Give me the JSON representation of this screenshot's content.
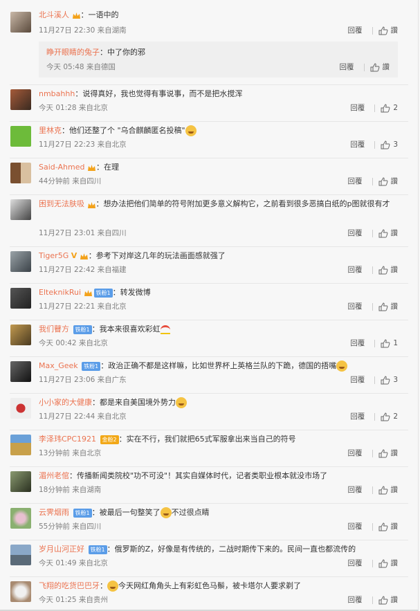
{
  "comments": [
    {
      "nick": "北斗溪人",
      "badge": "",
      "text": "一语中的",
      "emoji": "",
      "time": "11月27日 22:30 来自湖南",
      "reply": "回覆",
      "likes": "讚",
      "sub": {
        "nick": "睁开眼睛的兔子",
        "text": "中了你的邪",
        "time": "今天 05:48 来自德国",
        "reply": "回覆",
        "likes": "讚"
      }
    },
    {
      "nick": "nmbahhh",
      "badge": "",
      "text": "说得真好，我也觉得有事说事，而不是把水搅浑",
      "emoji": "",
      "time": "今天 01:28 来自北京",
      "reply": "回覆",
      "likes": "2"
    },
    {
      "nick": "里林克",
      "badge": "",
      "text": "他们还整了个 \"乌合麒麟匿名投稿\"",
      "emoji": "laugh",
      "time": "11月27日 22:23 来自北京",
      "reply": "回覆",
      "likes": "3"
    },
    {
      "nick": "Said-Ahmed",
      "badge": "",
      "text": "在理",
      "emoji": "",
      "time": "44分钟前 来自四川",
      "reply": "回覆",
      "likes": "讚"
    },
    {
      "nick": "困到无法肤吸",
      "badge": "",
      "text": "想办法把他们简单的符号附加更多意义解构它，之前看到很多恶搞白纸的p图就很有才",
      "emoji": "",
      "time": "11月27日 23:01 来自四川",
      "reply": "回覆",
      "likes": "讚"
    },
    {
      "nick": "Tiger5G",
      "badge": "",
      "text": "参考下对岸这几年的玩法画面感就强了",
      "emoji": "",
      "time": "11月27日 22:42 来自福建",
      "reply": "回覆",
      "likes": "讚"
    },
    {
      "nick": "ElteknikRui",
      "badge": "铁粉1",
      "text": "转发微博",
      "emoji": "",
      "time": "11月27日 22:21 来自北京",
      "reply": "回覆",
      "likes": "讚"
    },
    {
      "nick": "我们瞽方",
      "badge": "铁粉1",
      "text": "我本来很喜欢彩虹",
      "emoji": "rainbow",
      "time": "今天 00:42 来自北京",
      "reply": "回覆",
      "likes": "1"
    },
    {
      "nick": "Max_Geek",
      "badge": "铁粉1",
      "text": "政治正确不都是这样嘛，比如世界杯上英格兰队的下跪，德国的捂嘴",
      "emoji": "laugh",
      "time": "11月27日 23:06 来自广东",
      "reply": "回覆",
      "likes": "3"
    },
    {
      "nick": "小小家的大健康",
      "badge": "",
      "text": "都是来自美国境外势力",
      "emoji": "laugh",
      "time": "11月27日 22:44 来自北京",
      "reply": "回覆",
      "likes": "2"
    },
    {
      "nick": "李泽玮CPC1921",
      "badge": "金粉2",
      "text": "实在不行，我们就把65式军服拿出来当自己的符号",
      "emoji": "",
      "time": "13分钟前 来自北京",
      "reply": "回覆",
      "likes": "讚"
    },
    {
      "nick": "湄州老倌",
      "badge": "",
      "text": "传播新闻类院校\"功不可没\"！其实自媒体时代，记者类职业根本就没市场了",
      "emoji": "",
      "time": "18分钟前 来自湖南",
      "reply": "回覆",
      "likes": "讚"
    },
    {
      "nick": "云霁烟雨",
      "badge": "铁粉1",
      "text": "被最后一句整笑了",
      "text2": "不过很点睛",
      "emoji": "laugh",
      "time": "55分钟前 来自四川",
      "reply": "回覆",
      "likes": "讚"
    },
    {
      "nick": "岁月山河正好",
      "badge": "铁粉1",
      "text": "俄罗斯的Z，好像是有传统的，二战时期传下来的。民间一直也都流传的",
      "emoji": "",
      "time": "今天 01:49 来自北京",
      "reply": "回覆",
      "likes": "讚"
    },
    {
      "nick": "飞翔的吃货巴巴牙",
      "badge": "",
      "text": "今天网红角角头上有彩虹色马鬃，被卡塔尔人要求剃了",
      "emoji": "laugh",
      "time": "今天 01:25 来自贵州",
      "reply": "回覆",
      "likes": "讚"
    }
  ],
  "colors": {
    "nick": "#eb7350",
    "meta": "#808080",
    "badge": "#5b9de8",
    "gold": "#f2a818",
    "bg": "#f7f7f7"
  }
}
